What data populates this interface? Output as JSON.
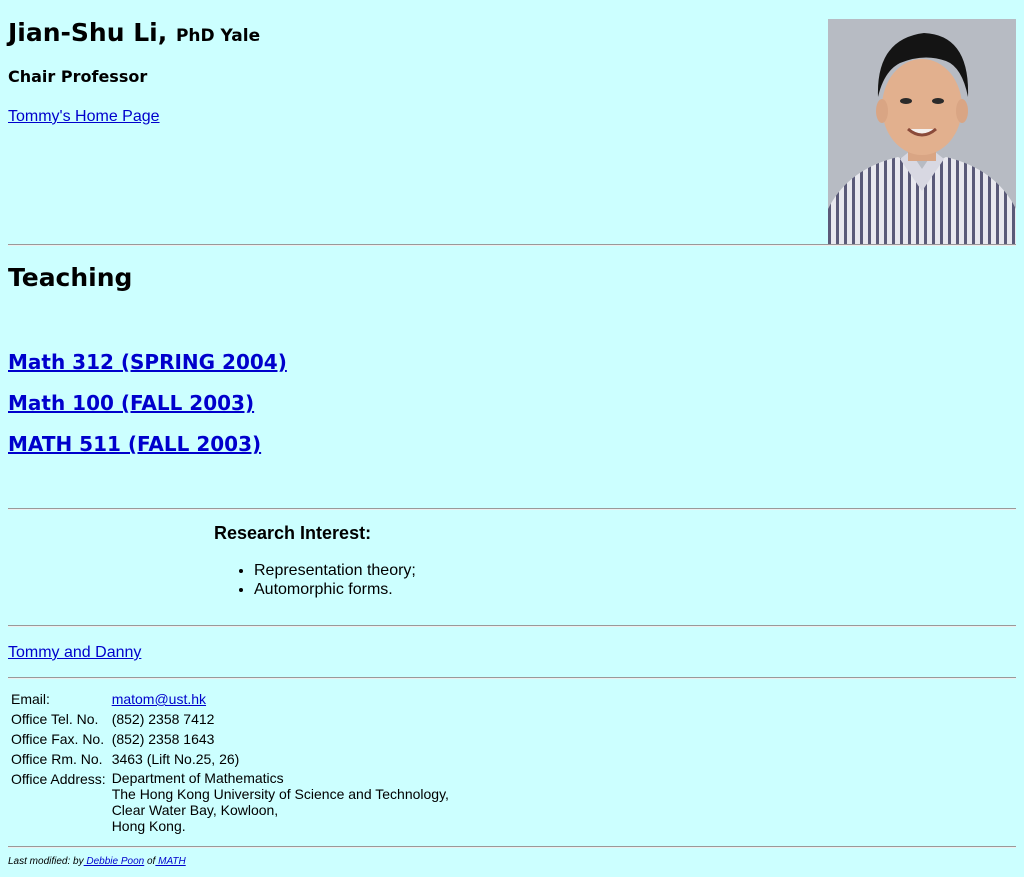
{
  "header": {
    "name": "Jian-Shu Li,",
    "degree": "PhD Yale",
    "position": "Chair Professor",
    "home_link": "Tommy's Home Page"
  },
  "teaching": {
    "heading": "Teaching",
    "courses": [
      "Math 312 (SPRING 2004)",
      "Math 100 (FALL 2003)",
      "MATH 511 (FALL 2003)"
    ]
  },
  "research": {
    "heading": "Research Interest:",
    "items": [
      "Representation theory;",
      "Automorphic forms."
    ]
  },
  "friends_link": "Tommy and Danny",
  "contact": {
    "email_label": "Email:",
    "email": "matom@ust.hk",
    "tel_label": "Office Tel. No.",
    "tel": "(852) 2358 7412",
    "fax_label": "Office Fax. No.",
    "fax": "(852) 2358 1643",
    "room_label": "Office Rm. No.",
    "room": "3463 (Lift No.25, 26)",
    "address_label": "Office Address:",
    "address_lines": [
      "Department of Mathematics",
      "The Hong Kong University of Science and Technology,",
      "Clear Water Bay, Kowloon,",
      "Hong Kong."
    ]
  },
  "footer": {
    "prefix": "Last modified: by",
    "author": " Debbie Poon",
    "of": " of",
    "dept": " MATH"
  },
  "colors": {
    "background": "#ccffff",
    "link": "#0000cc"
  }
}
